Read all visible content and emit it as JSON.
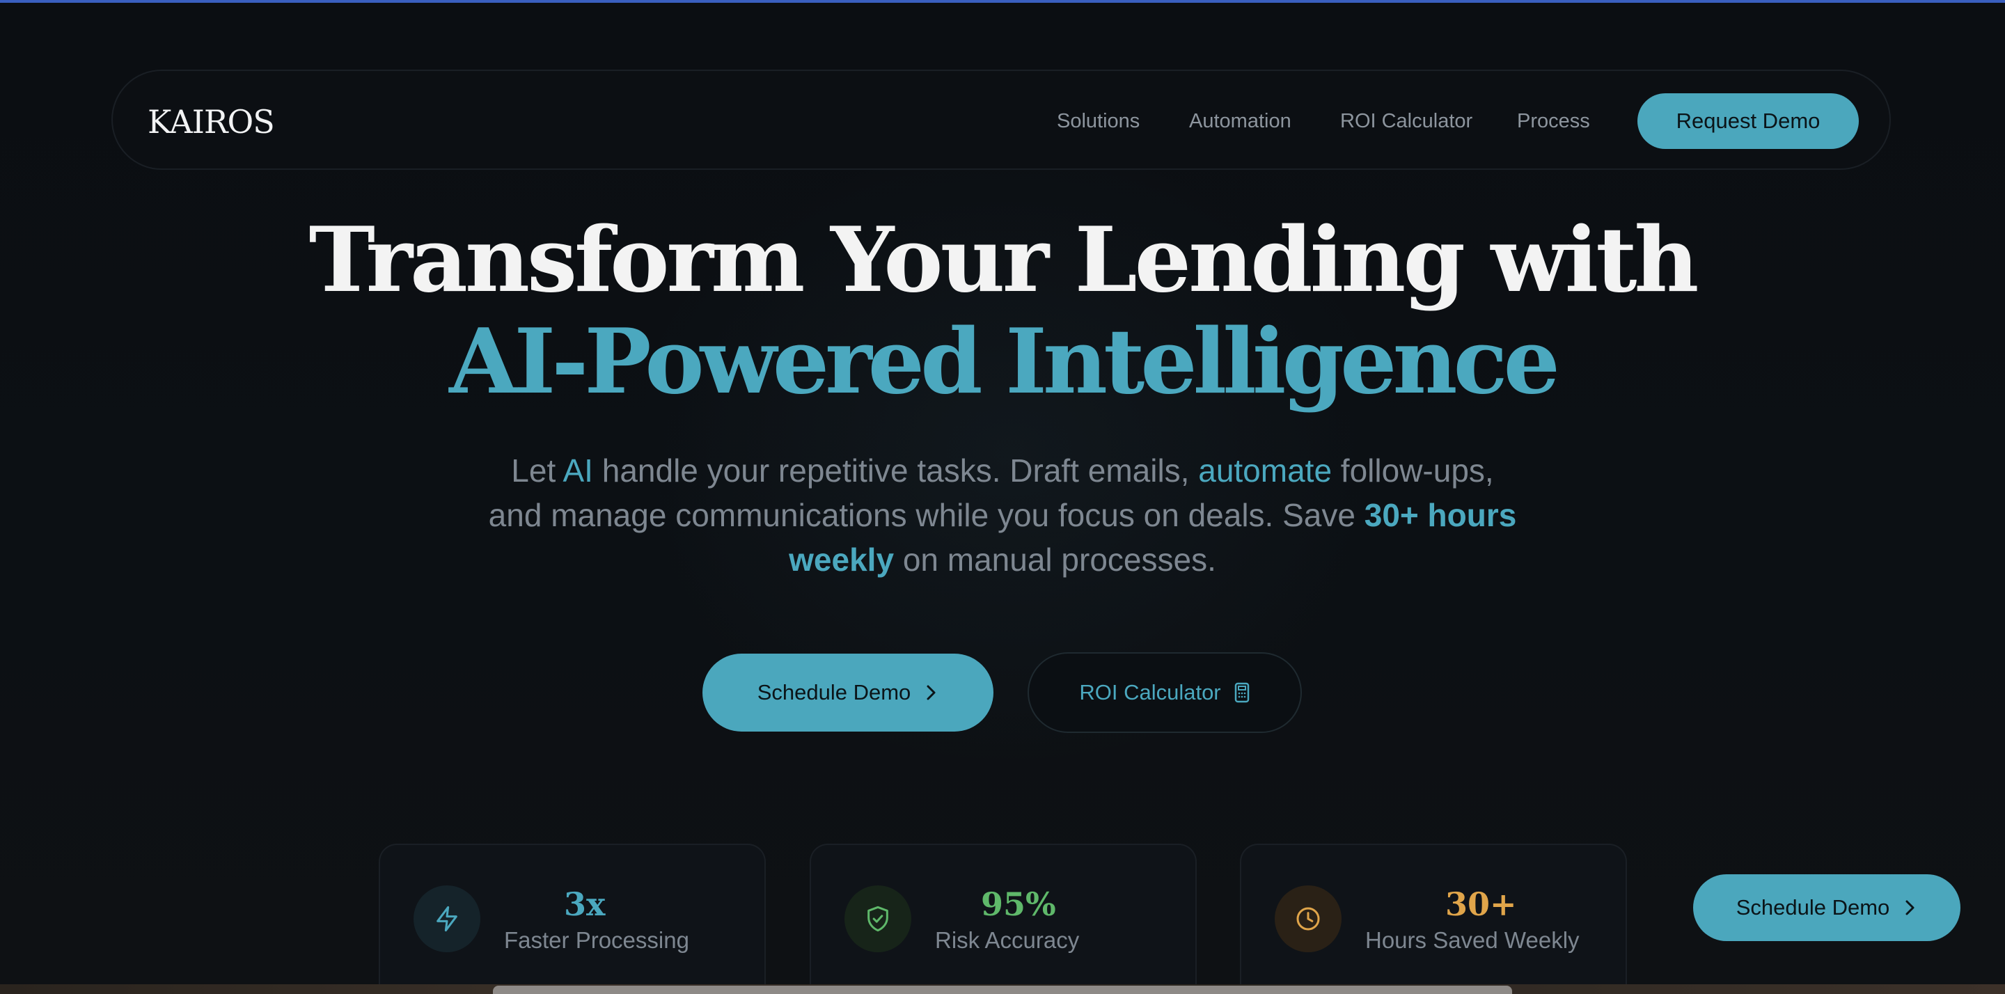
{
  "nav": {
    "logo": "KAIROS",
    "links": [
      "Solutions",
      "Automation",
      "ROI Calculator",
      "Process"
    ],
    "cta": "Request Demo"
  },
  "hero": {
    "headline_line1": "Transform Your Lending with",
    "headline_line2": "AI-Powered Intelligence",
    "subtitle": {
      "p1": "Let ",
      "h1": "AI",
      "p2": " handle your repetitive tasks. Draft emails, ",
      "h2": "automate",
      "p3": " follow-ups, and manage communications while you focus on deals. Save ",
      "h3": "30+ hours weekly",
      "p4": " on manual processes."
    },
    "primary_button": "Schedule Demo",
    "secondary_button": "ROI Calculator"
  },
  "stats": [
    {
      "value": "3x",
      "label": "Faster Processing",
      "icon": "lightning-icon",
      "color": "#4ba8bf"
    },
    {
      "value": "95%",
      "label": "Risk Accuracy",
      "icon": "shield-check-icon",
      "color": "#5fb86a"
    },
    {
      "value": "30+",
      "label": "Hours Saved Weekly",
      "icon": "clock-icon",
      "color": "#e0a54a"
    }
  ],
  "floating_cta": "Schedule Demo",
  "colors": {
    "accent": "#4ba7bd",
    "background": "#0b0e12",
    "text_muted": "#7e8791",
    "green": "#5fb86a",
    "amber": "#e0a54a"
  }
}
